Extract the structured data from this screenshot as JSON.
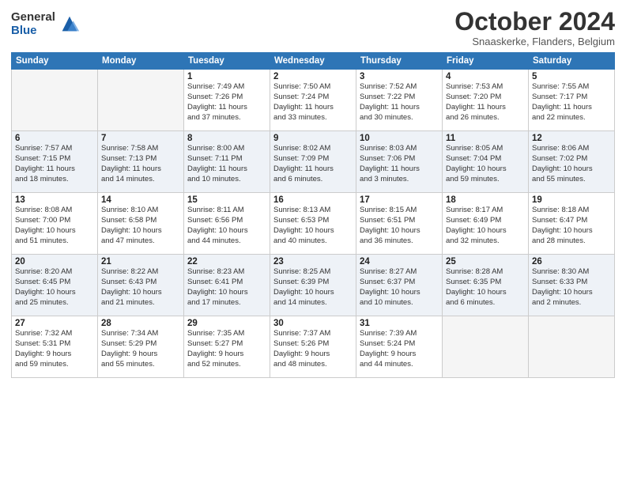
{
  "header": {
    "logo_general": "General",
    "logo_blue": "Blue",
    "month": "October 2024",
    "location": "Snaaskerke, Flanders, Belgium"
  },
  "days_of_week": [
    "Sunday",
    "Monday",
    "Tuesday",
    "Wednesday",
    "Thursday",
    "Friday",
    "Saturday"
  ],
  "weeks": [
    [
      {
        "day": "",
        "info": ""
      },
      {
        "day": "",
        "info": ""
      },
      {
        "day": "1",
        "info": "Sunrise: 7:49 AM\nSunset: 7:26 PM\nDaylight: 11 hours\nand 37 minutes."
      },
      {
        "day": "2",
        "info": "Sunrise: 7:50 AM\nSunset: 7:24 PM\nDaylight: 11 hours\nand 33 minutes."
      },
      {
        "day": "3",
        "info": "Sunrise: 7:52 AM\nSunset: 7:22 PM\nDaylight: 11 hours\nand 30 minutes."
      },
      {
        "day": "4",
        "info": "Sunrise: 7:53 AM\nSunset: 7:20 PM\nDaylight: 11 hours\nand 26 minutes."
      },
      {
        "day": "5",
        "info": "Sunrise: 7:55 AM\nSunset: 7:17 PM\nDaylight: 11 hours\nand 22 minutes."
      }
    ],
    [
      {
        "day": "6",
        "info": "Sunrise: 7:57 AM\nSunset: 7:15 PM\nDaylight: 11 hours\nand 18 minutes."
      },
      {
        "day": "7",
        "info": "Sunrise: 7:58 AM\nSunset: 7:13 PM\nDaylight: 11 hours\nand 14 minutes."
      },
      {
        "day": "8",
        "info": "Sunrise: 8:00 AM\nSunset: 7:11 PM\nDaylight: 11 hours\nand 10 minutes."
      },
      {
        "day": "9",
        "info": "Sunrise: 8:02 AM\nSunset: 7:09 PM\nDaylight: 11 hours\nand 6 minutes."
      },
      {
        "day": "10",
        "info": "Sunrise: 8:03 AM\nSunset: 7:06 PM\nDaylight: 11 hours\nand 3 minutes."
      },
      {
        "day": "11",
        "info": "Sunrise: 8:05 AM\nSunset: 7:04 PM\nDaylight: 10 hours\nand 59 minutes."
      },
      {
        "day": "12",
        "info": "Sunrise: 8:06 AM\nSunset: 7:02 PM\nDaylight: 10 hours\nand 55 minutes."
      }
    ],
    [
      {
        "day": "13",
        "info": "Sunrise: 8:08 AM\nSunset: 7:00 PM\nDaylight: 10 hours\nand 51 minutes."
      },
      {
        "day": "14",
        "info": "Sunrise: 8:10 AM\nSunset: 6:58 PM\nDaylight: 10 hours\nand 47 minutes."
      },
      {
        "day": "15",
        "info": "Sunrise: 8:11 AM\nSunset: 6:56 PM\nDaylight: 10 hours\nand 44 minutes."
      },
      {
        "day": "16",
        "info": "Sunrise: 8:13 AM\nSunset: 6:53 PM\nDaylight: 10 hours\nand 40 minutes."
      },
      {
        "day": "17",
        "info": "Sunrise: 8:15 AM\nSunset: 6:51 PM\nDaylight: 10 hours\nand 36 minutes."
      },
      {
        "day": "18",
        "info": "Sunrise: 8:17 AM\nSunset: 6:49 PM\nDaylight: 10 hours\nand 32 minutes."
      },
      {
        "day": "19",
        "info": "Sunrise: 8:18 AM\nSunset: 6:47 PM\nDaylight: 10 hours\nand 28 minutes."
      }
    ],
    [
      {
        "day": "20",
        "info": "Sunrise: 8:20 AM\nSunset: 6:45 PM\nDaylight: 10 hours\nand 25 minutes."
      },
      {
        "day": "21",
        "info": "Sunrise: 8:22 AM\nSunset: 6:43 PM\nDaylight: 10 hours\nand 21 minutes."
      },
      {
        "day": "22",
        "info": "Sunrise: 8:23 AM\nSunset: 6:41 PM\nDaylight: 10 hours\nand 17 minutes."
      },
      {
        "day": "23",
        "info": "Sunrise: 8:25 AM\nSunset: 6:39 PM\nDaylight: 10 hours\nand 14 minutes."
      },
      {
        "day": "24",
        "info": "Sunrise: 8:27 AM\nSunset: 6:37 PM\nDaylight: 10 hours\nand 10 minutes."
      },
      {
        "day": "25",
        "info": "Sunrise: 8:28 AM\nSunset: 6:35 PM\nDaylight: 10 hours\nand 6 minutes."
      },
      {
        "day": "26",
        "info": "Sunrise: 8:30 AM\nSunset: 6:33 PM\nDaylight: 10 hours\nand 2 minutes."
      }
    ],
    [
      {
        "day": "27",
        "info": "Sunrise: 7:32 AM\nSunset: 5:31 PM\nDaylight: 9 hours\nand 59 minutes."
      },
      {
        "day": "28",
        "info": "Sunrise: 7:34 AM\nSunset: 5:29 PM\nDaylight: 9 hours\nand 55 minutes."
      },
      {
        "day": "29",
        "info": "Sunrise: 7:35 AM\nSunset: 5:27 PM\nDaylight: 9 hours\nand 52 minutes."
      },
      {
        "day": "30",
        "info": "Sunrise: 7:37 AM\nSunset: 5:26 PM\nDaylight: 9 hours\nand 48 minutes."
      },
      {
        "day": "31",
        "info": "Sunrise: 7:39 AM\nSunset: 5:24 PM\nDaylight: 9 hours\nand 44 minutes."
      },
      {
        "day": "",
        "info": ""
      },
      {
        "day": "",
        "info": ""
      }
    ]
  ]
}
